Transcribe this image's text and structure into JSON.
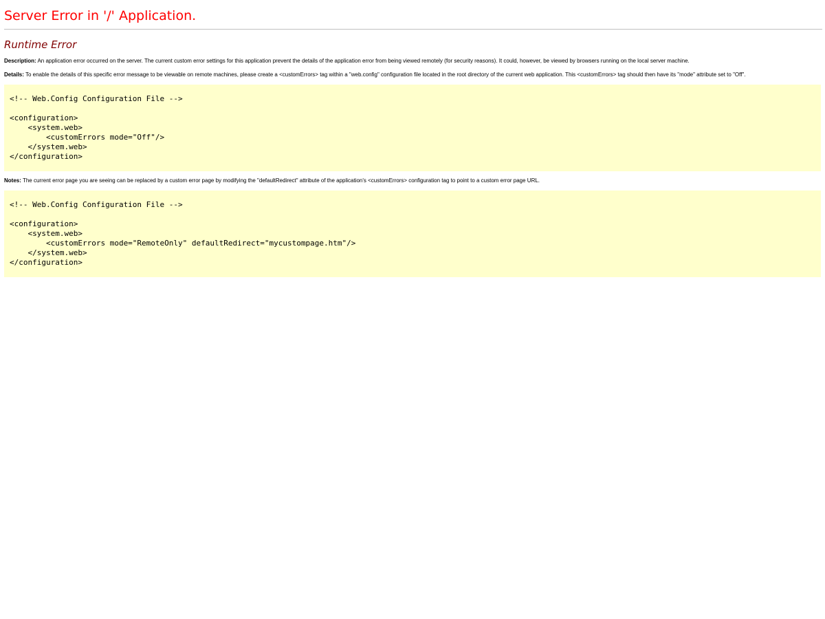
{
  "page": {
    "title": "Server Error in '/' Application.",
    "subtitle": "Runtime Error"
  },
  "description": {
    "label": "Description:",
    "text": " An application error occurred on the server. The current custom error settings for this application prevent the details of the application error from being viewed remotely (for security reasons). It could, however, be viewed by browsers running on the local server machine."
  },
  "details": {
    "label": "Details:",
    "text": " To enable the details of this specific error message to be viewable on remote machines, please create a <customErrors> tag within a \"web.config\" configuration file located in the root directory of the current web application. This <customErrors> tag should then have its \"mode\" attribute set to \"Off\"."
  },
  "code_block_1": "<!-- Web.Config Configuration File -->\n\n<configuration>\n    <system.web>\n        <customErrors mode=\"Off\"/>\n    </system.web>\n</configuration>",
  "notes": {
    "label": "Notes:",
    "text": " The current error page you are seeing can be replaced by a custom error page by modifying the \"defaultRedirect\" attribute of the application's <customErrors> configuration tag to point to a custom error page URL."
  },
  "code_block_2": "<!-- Web.Config Configuration File -->\n\n<configuration>\n    <system.web>\n        <customErrors mode=\"RemoteOnly\" defaultRedirect=\"mycustompage.htm\"/>\n    </system.web>\n</configuration>",
  "colors": {
    "title": "#ff0000",
    "subtitle": "#800000",
    "code_background": "#ffffcc",
    "rule": "#c0c0c0"
  }
}
